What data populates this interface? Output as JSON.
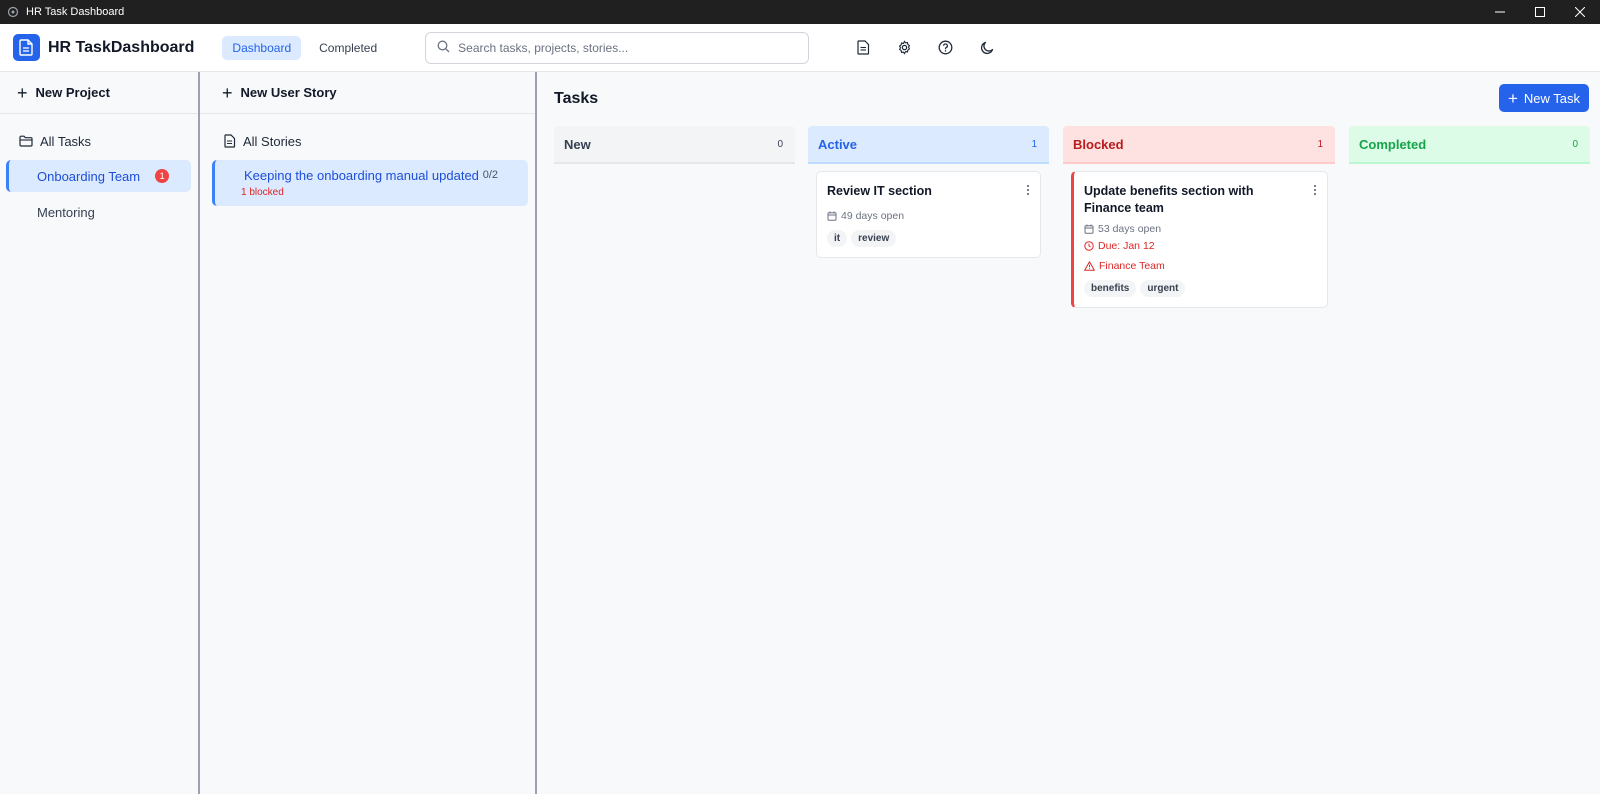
{
  "window": {
    "title": "HR Task Dashboard"
  },
  "header": {
    "brand": "HR TaskDashboard",
    "tabs": [
      {
        "label": "Dashboard",
        "active": true
      },
      {
        "label": "Completed",
        "active": false
      }
    ],
    "search_placeholder": "Search tasks, projects, stories..."
  },
  "projects": {
    "new_label": "New Project",
    "all_label": "All Tasks",
    "items": [
      {
        "label": "Onboarding Team",
        "badge": "1",
        "active": true
      },
      {
        "label": "Mentoring",
        "active": false
      }
    ]
  },
  "stories": {
    "new_label": "New User Story",
    "all_label": "All Stories",
    "items": [
      {
        "title": "Keeping the onboarding manual updated",
        "count": "0/2",
        "blocked": "1 blocked"
      }
    ]
  },
  "main": {
    "title": "Tasks",
    "new_task_label": "New Task",
    "columns": [
      {
        "label": "New",
        "count": "0"
      },
      {
        "label": "Active",
        "count": "1"
      },
      {
        "label": "Blocked",
        "count": "1"
      },
      {
        "label": "Completed",
        "count": "0"
      }
    ],
    "active_card": {
      "title": "Review IT section",
      "open": "49 days open",
      "tags": [
        "it",
        "review"
      ]
    },
    "blocked_card": {
      "title": "Update benefits section with Finance team",
      "open": "53 days open",
      "due": "Due: Jan 12",
      "blocked_by": "Finance Team",
      "tags": [
        "benefits",
        "urgent"
      ]
    }
  },
  "colors": {
    "accent": "#2563eb",
    "blocked": "#ef4444",
    "completed": "#16a34a"
  }
}
